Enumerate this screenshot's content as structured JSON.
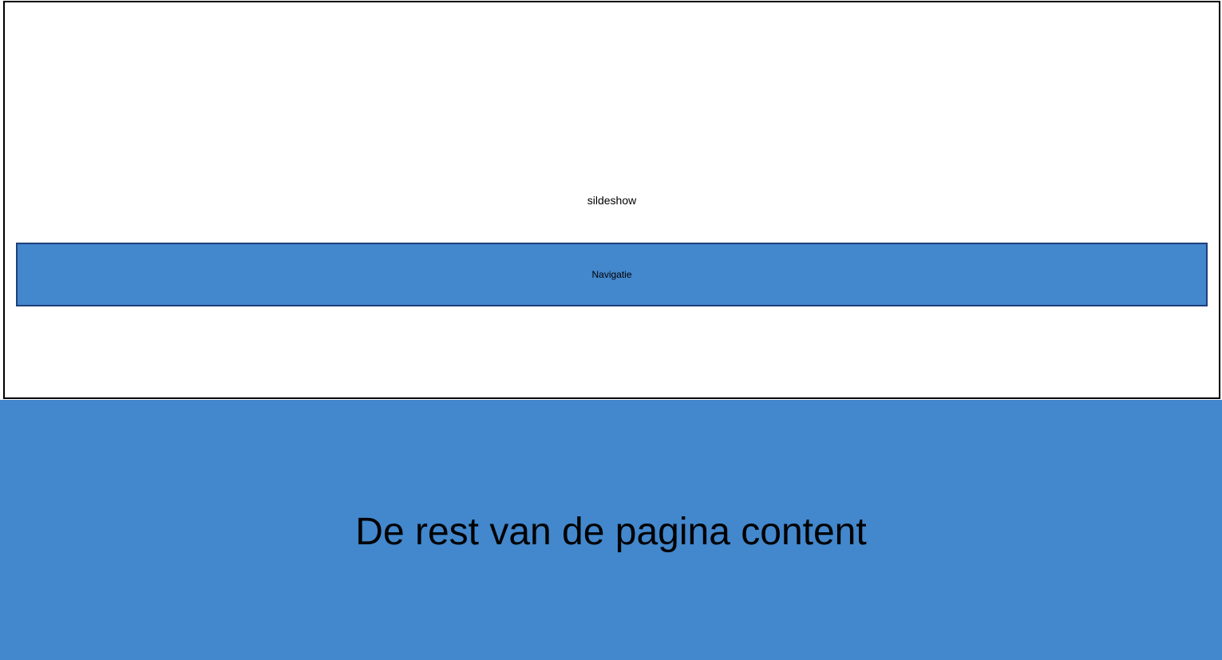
{
  "slideshow": {
    "label": "sildeshow"
  },
  "navigation": {
    "label": "Navigatie"
  },
  "content": {
    "label": "De rest van de pagina content"
  },
  "colors": {
    "block_fill": "#4387cc",
    "nav_border": "#1f3f7a",
    "outline": "#000000",
    "background": "#ffffff"
  }
}
